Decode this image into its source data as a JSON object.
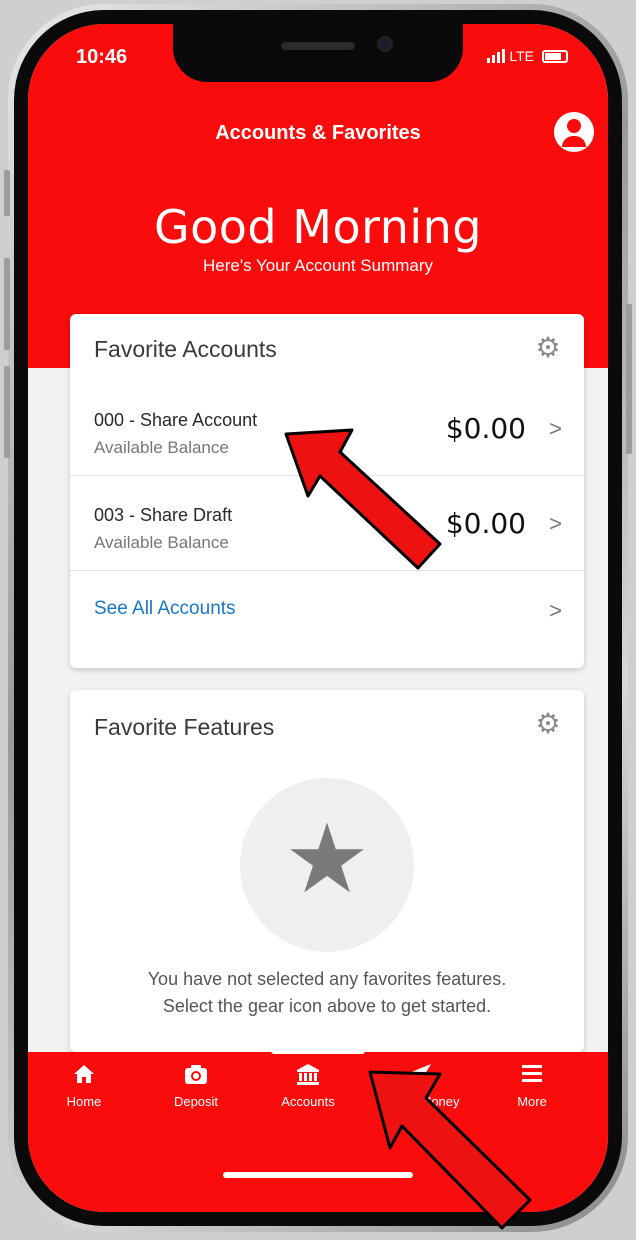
{
  "status_bar": {
    "time": "10:46",
    "network": "LTE"
  },
  "header": {
    "title": "Accounts & Favorites",
    "greeting": "Good Morning",
    "subtitle": "Here's Your Account Summary"
  },
  "favorite_accounts": {
    "title": "Favorite Accounts",
    "accounts": [
      {
        "name": "000 - Share Account",
        "label": "Available Balance",
        "balance": "$0.00"
      },
      {
        "name": "003 - Share Draft",
        "label": "Available Balance",
        "balance": "$0.00"
      }
    ],
    "see_all": "See All Accounts"
  },
  "favorite_features": {
    "title": "Favorite Features",
    "empty_line1": "You have not selected any favorites features.",
    "empty_line2": "Select the gear icon above to get started."
  },
  "tabs": [
    {
      "label": "Home",
      "icon": "home-icon"
    },
    {
      "label": "Deposit",
      "icon": "camera-icon"
    },
    {
      "label": "Accounts",
      "icon": "bank-icon"
    },
    {
      "label": "Money",
      "icon": "send-icon"
    },
    {
      "label": "More",
      "icon": "menu-icon"
    }
  ],
  "colors": {
    "brand": "#fa0c0c",
    "link": "#1877c9",
    "background": "#f2f2f2",
    "annotation_arrow": "#ee1111"
  }
}
